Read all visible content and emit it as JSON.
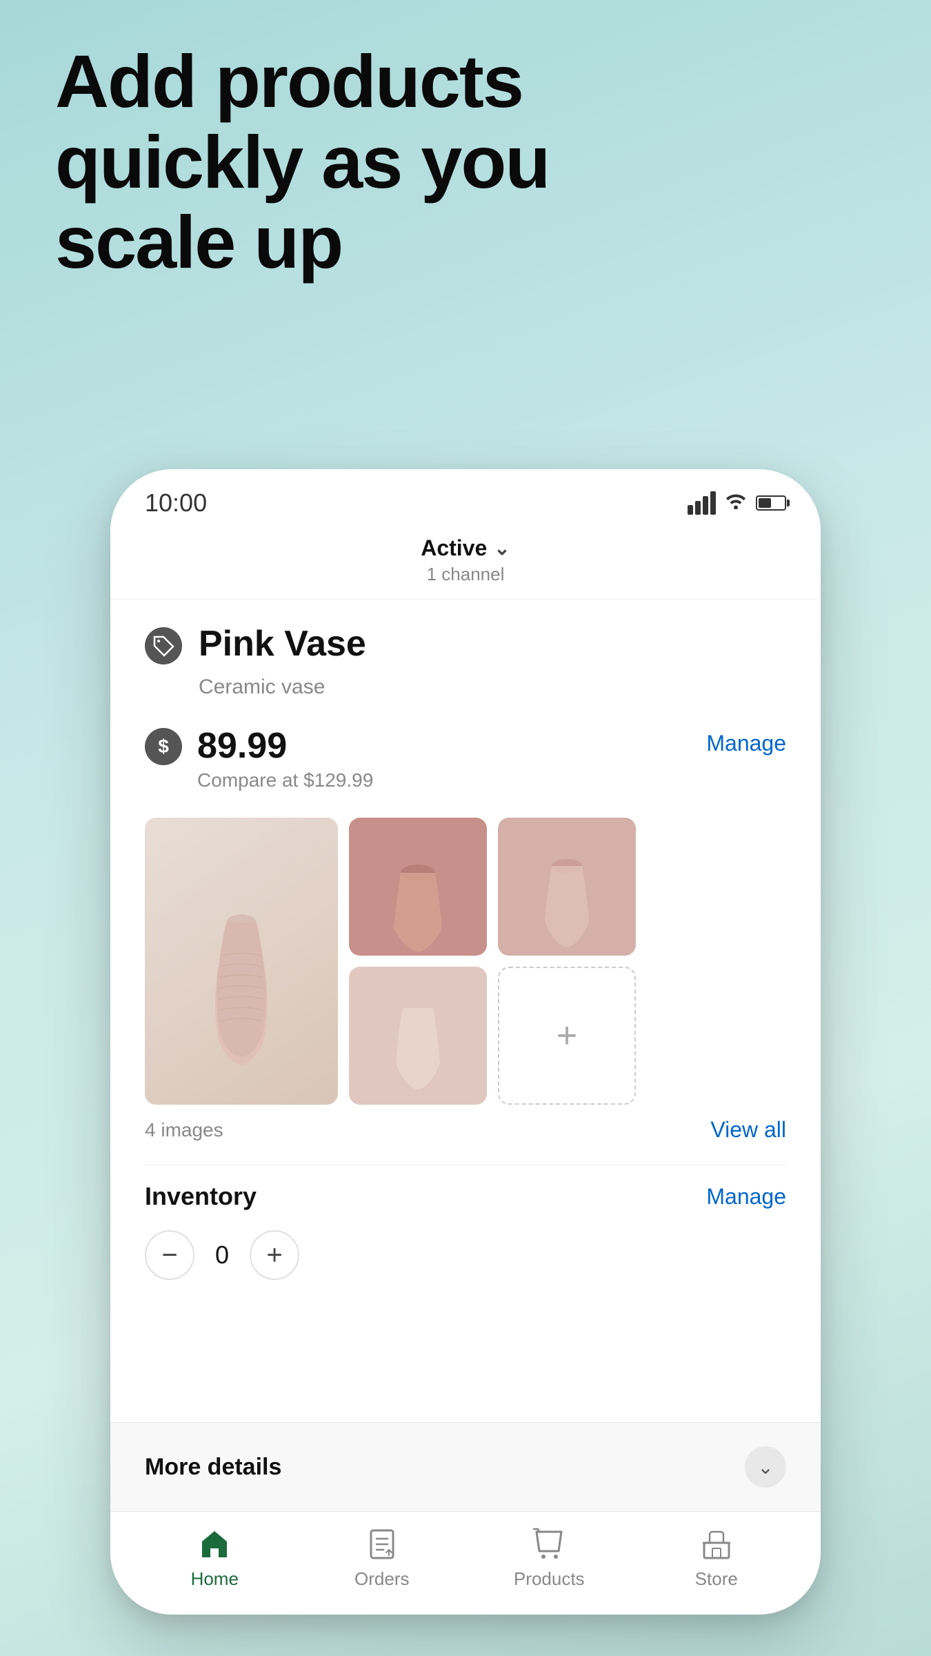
{
  "headline": {
    "line1": "Add products",
    "line2": "quickly as you",
    "line3": "scale up"
  },
  "statusBar": {
    "time": "10:00"
  },
  "channelHeader": {
    "status": "Active",
    "subtext": "1 channel"
  },
  "product": {
    "name": "Pink Vase",
    "type": "Ceramic vase",
    "price": "89.99",
    "compareAt": "Compare at $129.99",
    "manageLabel": "Manage",
    "imagesCount": "4 images",
    "viewAllLabel": "View all",
    "inventoryLabel": "Inventory",
    "inventoryManageLabel": "Manage",
    "inventoryValue": "0",
    "decrementLabel": "−",
    "incrementLabel": "+"
  },
  "moreDetails": {
    "label": "More details"
  },
  "bottomNav": {
    "items": [
      {
        "id": "home",
        "label": "Home",
        "active": true
      },
      {
        "id": "orders",
        "label": "Orders",
        "active": false
      },
      {
        "id": "products",
        "label": "Products",
        "active": false
      },
      {
        "id": "store",
        "label": "Store",
        "active": false
      }
    ]
  }
}
